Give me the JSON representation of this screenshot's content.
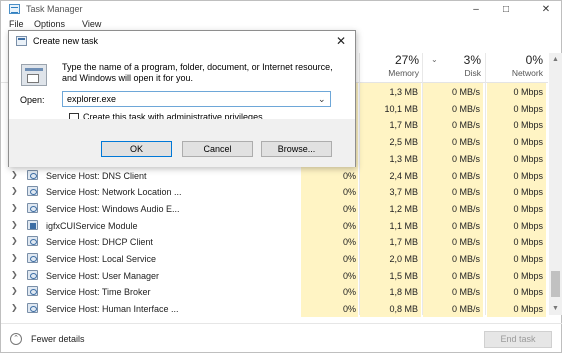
{
  "window": {
    "title": "Task Manager",
    "menu": [
      "File",
      "Options",
      "View"
    ]
  },
  "columns": {
    "memory": {
      "percent": "27%",
      "label": "Memory"
    },
    "disk": {
      "percent": "3%",
      "label": "Disk"
    },
    "network": {
      "percent": "0%",
      "label": "Network"
    }
  },
  "rows": [
    {
      "name": "",
      "cpu": "",
      "memory": "1,3 MB",
      "disk": "0 MB/s",
      "network": "0 Mbps",
      "icon": "service-icon"
    },
    {
      "name": "",
      "cpu": "",
      "memory": "10,1 MB",
      "disk": "0 MB/s",
      "network": "0 Mbps",
      "icon": "service-icon"
    },
    {
      "name": "",
      "cpu": "",
      "memory": "1,7 MB",
      "disk": "0 MB/s",
      "network": "0 Mbps",
      "icon": "service-icon"
    },
    {
      "name": "",
      "cpu": "",
      "memory": "2,5 MB",
      "disk": "0 MB/s",
      "network": "0 Mbps",
      "icon": "service-icon"
    },
    {
      "name": "",
      "cpu": "",
      "memory": "1,3 MB",
      "disk": "0 MB/s",
      "network": "0 Mbps",
      "icon": "service-icon"
    },
    {
      "name": "Service Host: DNS Client",
      "cpu": "0%",
      "memory": "2,4 MB",
      "disk": "0 MB/s",
      "network": "0 Mbps",
      "icon": "service-icon"
    },
    {
      "name": "Service Host: Network Location ...",
      "cpu": "0%",
      "memory": "3,7 MB",
      "disk": "0 MB/s",
      "network": "0 Mbps",
      "icon": "service-icon"
    },
    {
      "name": "Service Host: Windows Audio E...",
      "cpu": "0%",
      "memory": "1,2 MB",
      "disk": "0 MB/s",
      "network": "0 Mbps",
      "icon": "service-icon"
    },
    {
      "name": "igfxCUIService Module",
      "cpu": "0%",
      "memory": "1,1 MB",
      "disk": "0 MB/s",
      "network": "0 Mbps",
      "icon": "app-icon"
    },
    {
      "name": "Service Host: DHCP Client",
      "cpu": "0%",
      "memory": "1,7 MB",
      "disk": "0 MB/s",
      "network": "0 Mbps",
      "icon": "service-icon"
    },
    {
      "name": "Service Host: Local Service",
      "cpu": "0%",
      "memory": "2,0 MB",
      "disk": "0 MB/s",
      "network": "0 Mbps",
      "icon": "service-icon"
    },
    {
      "name": "Service Host: User Manager",
      "cpu": "0%",
      "memory": "1,5 MB",
      "disk": "0 MB/s",
      "network": "0 Mbps",
      "icon": "service-icon"
    },
    {
      "name": "Service Host: Time Broker",
      "cpu": "0%",
      "memory": "1,8 MB",
      "disk": "0 MB/s",
      "network": "0 Mbps",
      "icon": "service-icon"
    },
    {
      "name": "Service Host: Human Interface ...",
      "cpu": "0%",
      "memory": "0,8 MB",
      "disk": "0 MB/s",
      "network": "0 Mbps",
      "icon": "service-icon"
    }
  ],
  "footer": {
    "fewer_details": "Fewer details",
    "end_task": "End task"
  },
  "dialog": {
    "title": "Create new task",
    "description": "Type the name of a program, folder, document, or Internet resource, and Windows will open it for you.",
    "open_label": "Open:",
    "open_value": "explorer.exe",
    "admin_label": "Create this task with administrative privileges.",
    "ok": "OK",
    "cancel": "Cancel",
    "browse": "Browse..."
  },
  "colors": {
    "heat_cell": "#fff4c4",
    "accent": "#0078d7"
  }
}
